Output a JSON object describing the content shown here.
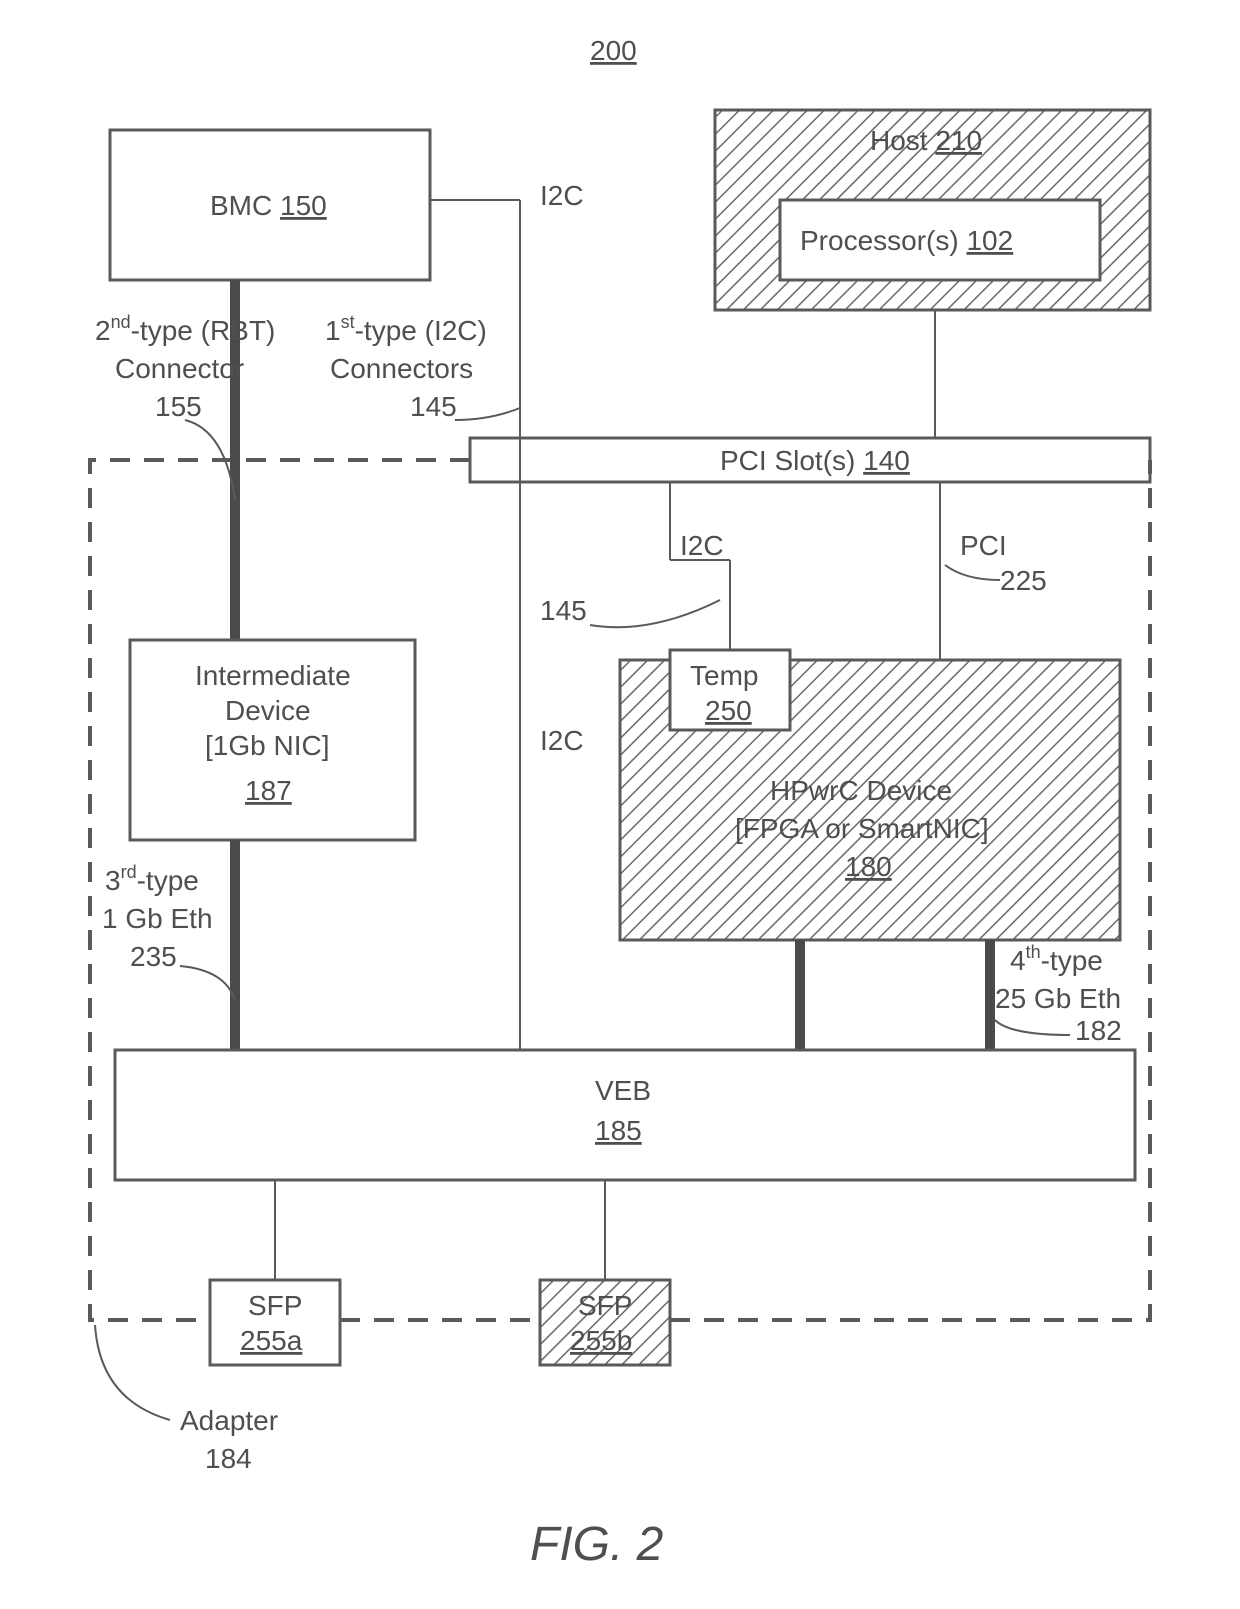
{
  "figure_number_top": "200",
  "figure_caption": "FIG. 2",
  "bmc": {
    "label": "BMC",
    "ref": "150"
  },
  "host": {
    "label": "Host",
    "ref": "210"
  },
  "processor": {
    "label": "Processor(s)",
    "ref": "102"
  },
  "conn2": {
    "line1_pre": "2",
    "line1_sup": "nd",
    "line1_post": "-type (RBT)",
    "line2": "Connector",
    "line3": "155"
  },
  "conn1": {
    "line1_pre": "1",
    "line1_sup": "st",
    "line1_post": "-type (I2C)",
    "line2": "Connectors",
    "line3": "145"
  },
  "i2c_label": "I2C",
  "i2c_ref": "145",
  "pci_label": "PCI",
  "pci_ref": "225",
  "pci_slot": {
    "label": "PCI Slot(s)",
    "ref": "140"
  },
  "intermediate": {
    "label": "Intermediate",
    "label2": "Device",
    "label3": "[1Gb NIC]",
    "ref": "187"
  },
  "temp": {
    "label": "Temp",
    "ref": "250"
  },
  "hpwrc": {
    "label": "HPwrC Device",
    "label2": "[FPGA or SmartNIC]",
    "ref": "180"
  },
  "conn3": {
    "line1_pre": "3",
    "line1_sup": "rd",
    "line1_post": "-type",
    "line2": "1 Gb Eth",
    "line3": "235"
  },
  "conn4": {
    "line1_pre": "4",
    "line1_sup": "th",
    "line1_post": "-type",
    "line2": "25 Gb Eth",
    "line3": "182"
  },
  "veb": {
    "label": "VEB",
    "ref": "185"
  },
  "sfp_a": {
    "label": "SFP",
    "ref": "255a"
  },
  "sfp_b": {
    "label": "SFP",
    "ref": "255b"
  },
  "adapter": {
    "label": "Adapter",
    "ref": "184"
  }
}
